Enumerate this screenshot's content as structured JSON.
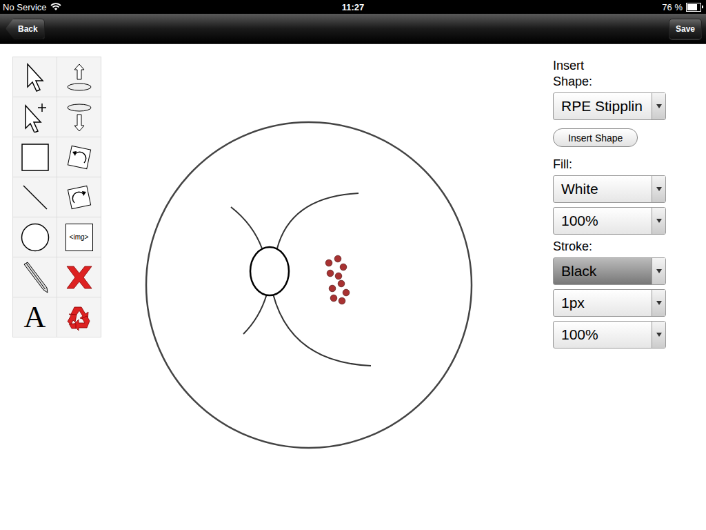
{
  "status_bar": {
    "carrier": "No Service",
    "time": "11:27",
    "battery": "76 %",
    "battery_level": 0.76
  },
  "nav_bar": {
    "back": "Back",
    "save": "Save"
  },
  "toolbar": {
    "image_tool_label": "<img>",
    "text_tool_label": "A"
  },
  "panel": [
    {
      "kind": "label",
      "text": "Insert Shape:"
    },
    {
      "kind": "select",
      "text": "RPE Stipplin",
      "dark": false
    },
    {
      "kind": "button",
      "text": "Insert Shape"
    },
    {
      "kind": "label",
      "text": "Fill:"
    },
    {
      "kind": "select",
      "text": "White",
      "dark": false
    },
    {
      "kind": "select",
      "text": "100%",
      "dark": false
    },
    {
      "kind": "label",
      "text": "Stroke:"
    },
    {
      "kind": "select",
      "text": "Black",
      "dark": true
    },
    {
      "kind": "select",
      "text": "1px",
      "dark": false
    },
    {
      "kind": "select",
      "text": "100%",
      "dark": false
    }
  ]
}
